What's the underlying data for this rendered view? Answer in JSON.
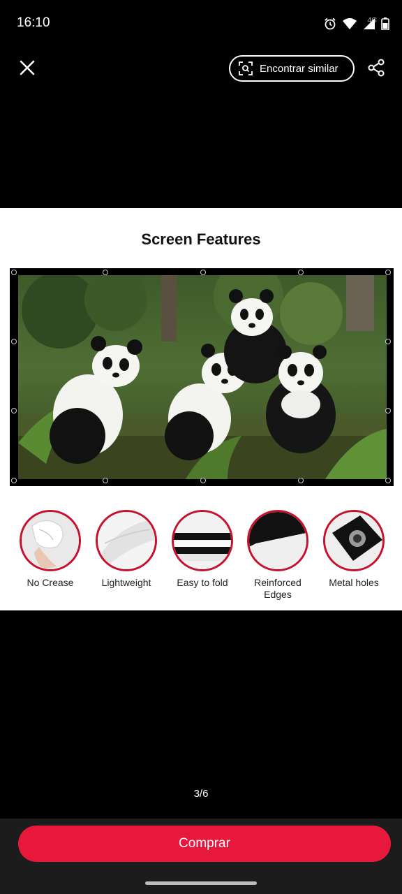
{
  "status": {
    "time": "16:10",
    "network": "4G"
  },
  "toolbar": {
    "find_similar_label": "Encontrar similar"
  },
  "product": {
    "title": "Screen Features",
    "features": [
      {
        "label": "No Crease"
      },
      {
        "label": "Lightweight"
      },
      {
        "label": "Easy to fold"
      },
      {
        "label": "Reinforced Edges"
      },
      {
        "label": "Metal holes"
      }
    ]
  },
  "gallery": {
    "counter": "3/6"
  },
  "action": {
    "buy_label": "Comprar"
  },
  "colors": {
    "accent": "#e8183c",
    "feature_ring": "#c8102e"
  }
}
